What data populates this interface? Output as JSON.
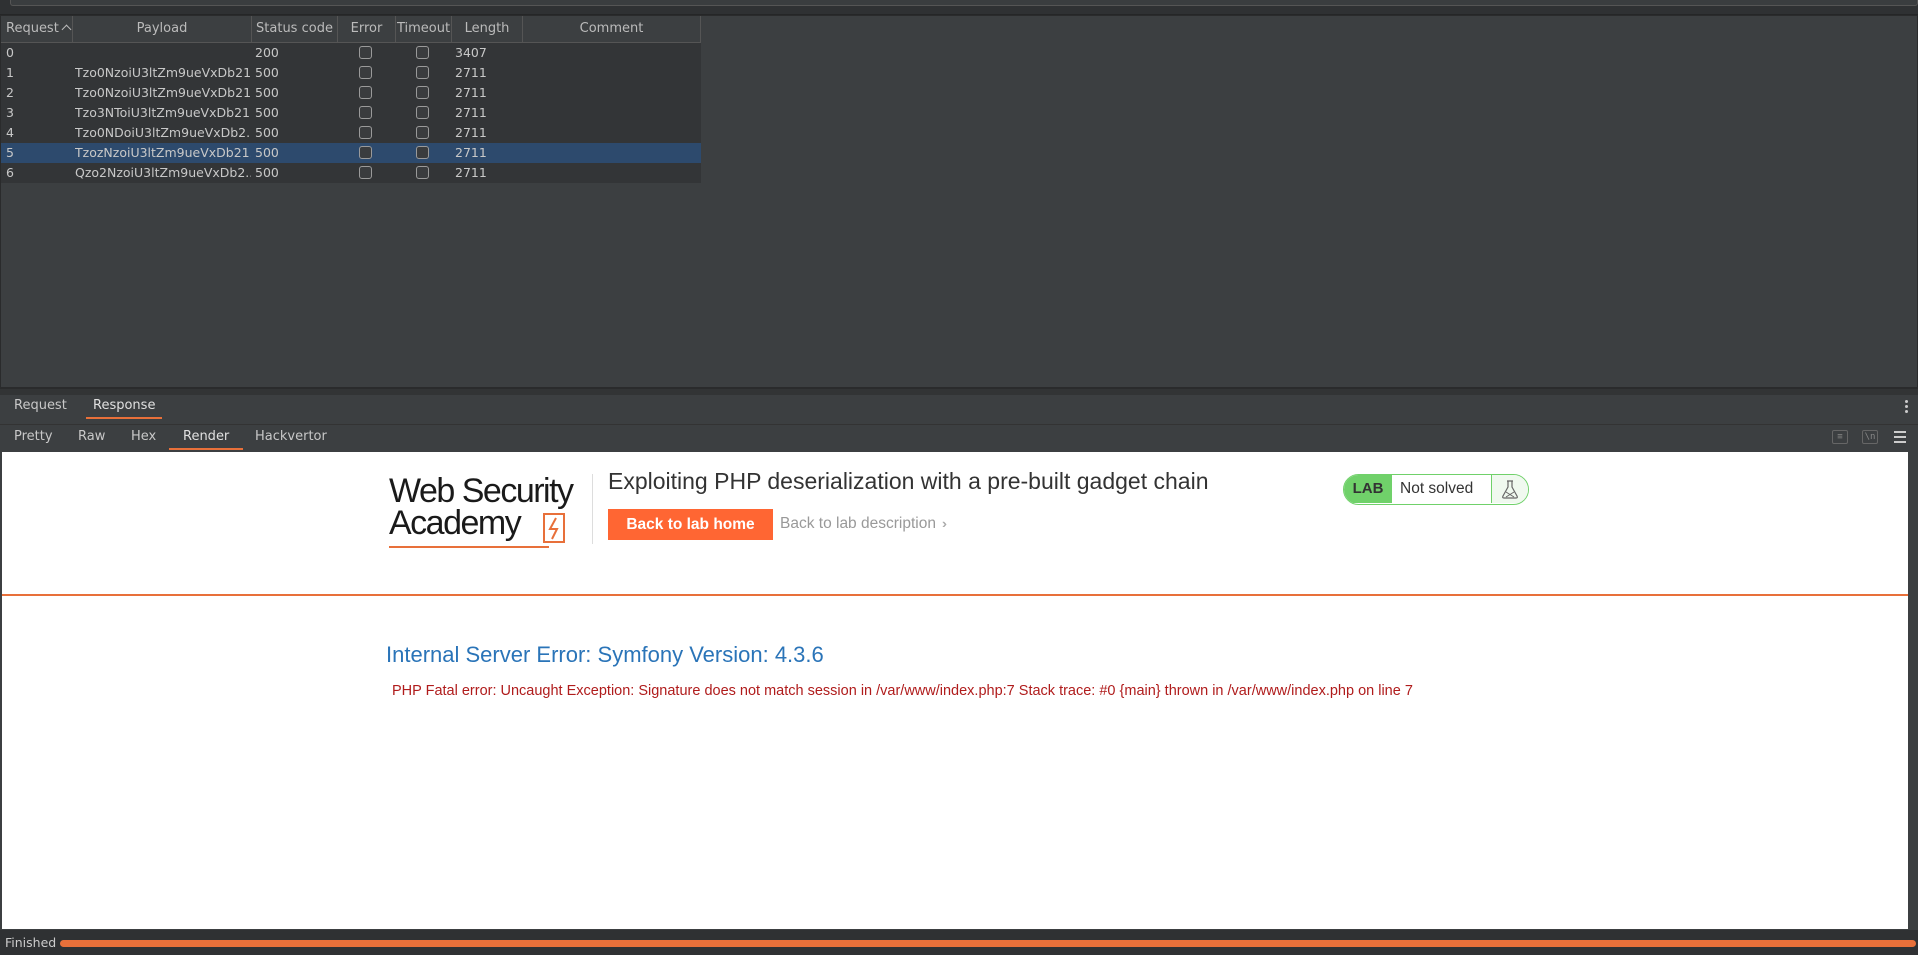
{
  "table": {
    "columns": {
      "request": "Request",
      "payload": "Payload",
      "status": "Status code",
      "error": "Error",
      "timeout": "Timeout",
      "length": "Length",
      "comment": "Comment"
    },
    "sort": "ascending",
    "rows": [
      {
        "request": "0",
        "payload": "",
        "status": "200",
        "error": false,
        "timeout": false,
        "length": "3407",
        "comment": ""
      },
      {
        "request": "1",
        "payload": "Tzo0NzoiU3ltZm9ueVxDb21...",
        "status": "500",
        "error": false,
        "timeout": false,
        "length": "2711",
        "comment": ""
      },
      {
        "request": "2",
        "payload": "Tzo0NzoiU3ltZm9ueVxDb21...",
        "status": "500",
        "error": false,
        "timeout": false,
        "length": "2711",
        "comment": ""
      },
      {
        "request": "3",
        "payload": "Tzo3NToiU3ltZm9ueVxDb21...",
        "status": "500",
        "error": false,
        "timeout": false,
        "length": "2711",
        "comment": ""
      },
      {
        "request": "4",
        "payload": "Tzo0NDoiU3ltZm9ueVxDb2...",
        "status": "500",
        "error": false,
        "timeout": false,
        "length": "2711",
        "comment": ""
      },
      {
        "request": "5",
        "payload": "TzozNzoiU3ltZm9ueVxDb21...",
        "status": "500",
        "error": false,
        "timeout": false,
        "length": "2711",
        "comment": "",
        "selected": true
      },
      {
        "request": "6",
        "payload": "Qzo2NzoiU3ltZm9ueVxDb2...",
        "status": "500",
        "error": false,
        "timeout": false,
        "length": "2711",
        "comment": ""
      }
    ]
  },
  "message_tabs": [
    "Request",
    "Response"
  ],
  "message_tab_active": "Response",
  "view_tabs": [
    "Pretty",
    "Raw",
    "Hex",
    "Render",
    "Hackvertor"
  ],
  "view_tab_active": "Render",
  "render": {
    "logo_line1": "Web Security",
    "logo_line2": "Academy",
    "lab_title": "Exploiting PHP deserialization with a pre-built gadget chain",
    "back_home": "Back to lab home",
    "back_description": "Back to lab description",
    "badge_lab": "LAB",
    "badge_status": "Not solved",
    "error_title": "Internal Server Error: Symfony Version: 4.3.6",
    "error_message": "PHP Fatal error: Uncaught Exception: Signature does not match session in /var/www/index.php:7 Stack trace: #0 {main} thrown in /var/www/index.php on line 7"
  },
  "status_bar": {
    "text": "Finished",
    "progress": 1.0
  },
  "colors": {
    "accent": "#e8703a",
    "selected_row": "#2d4a6d",
    "lab_green": "#70d16a",
    "error_blue": "#2a74b8",
    "error_red": "#b01c1c",
    "button_orange": "#ff6633"
  }
}
